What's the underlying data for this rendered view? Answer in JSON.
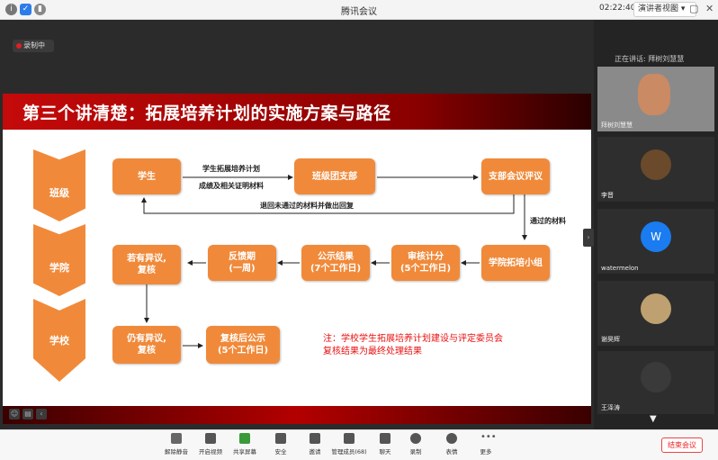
{
  "window": {
    "title": "腾讯会议",
    "time": "02:22:40",
    "view_label": "演讲者视图 ▾"
  },
  "recording": {
    "label": "录制中"
  },
  "slide": {
    "title": "第三个讲清楚：拓展培养计划的实施方案与路径",
    "levels": [
      "班级",
      "学院",
      "学校"
    ],
    "boxes": {
      "student": "学生",
      "class_branch": "班级团支部",
      "branch_review": "支部会议评议",
      "college_group": "学院拓培小组",
      "audit": "审核计分\n(5个工作日)",
      "publicity": "公示结果\n(7个工作日)",
      "feedback": "反馈期\n(一周)",
      "objection": "若有异议,\n复核",
      "still_objection": "仍有异议,\n复核",
      "review_publicity": "复核后公示\n(5个工作日)"
    },
    "labels": {
      "submit_1": "学生拓展培养计划",
      "submit_2": "成绩及相关证明材料",
      "return": "退回未通过的材料并做出回复",
      "passed": "通过的材料"
    },
    "note": "注：学校学生拓展培养计划建设与评定委员会\n复核结果为最终处理结果"
  },
  "sidebar": {
    "speaking": "正在讲话: 拜树刘慧慧",
    "participants": [
      {
        "name": "拜树刘慧慧",
        "avatar_color": "#c98a64"
      },
      {
        "name": "李晋",
        "avatar_color": "#6a4a2a"
      },
      {
        "name": "watermelon",
        "avatar_color": "#1a7cf0",
        "initial": "W"
      },
      {
        "name": "谢昊辉",
        "avatar_color": "#bfa070"
      },
      {
        "name": "王泽涛",
        "avatar_color": "#3a3a3a"
      }
    ]
  },
  "toolbar": {
    "items": [
      "解除静音",
      "开启视频",
      "共享屏幕",
      "安全",
      "邀请",
      "管理成员(68)",
      "聊天",
      "录制",
      "表情",
      "更多"
    ],
    "end_label": "结束会议"
  }
}
